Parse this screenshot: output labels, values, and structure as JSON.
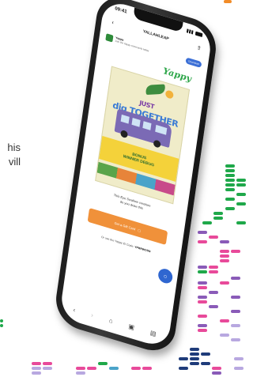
{
  "background_text": {
    "line1": "his",
    "line2": "vill"
  },
  "status_bar": {
    "time": "09:41"
  },
  "app_bar": {
    "title": "YALLAHLEAP",
    "back_icon": "back-arrow-icon",
    "share_icon": "share-icon"
  },
  "info_bar": {
    "name": "Yappy",
    "subtitle": "Join the Yappy community today",
    "button_label": "Download"
  },
  "brand": {
    "logo_text": "Yappy",
    "color": "#2ea64a"
  },
  "poster": {
    "headline_top": "JUST",
    "headline_main": "dig TOGETHER",
    "band_line1": "BONUS",
    "band_line2": "WINNER DEBUG"
  },
  "caption": {
    "line1": "This Eye Swallow creature",
    "line2": "do you draw this"
  },
  "cta": {
    "label": "Get a Gift Card",
    "color": "#f0913a"
  },
  "code_line": {
    "prefix": "Or use the Yappy ID Code:",
    "code": "YPBRWDSN"
  },
  "navbar": {
    "items": [
      "back-icon",
      "forward-icon",
      "home-icon",
      "tabs-icon",
      "bookmark-icon"
    ]
  },
  "decor_colors": {
    "pink": "#e84a9a",
    "green": "#1fa84a",
    "purple": "#8a5bb8",
    "orange": "#f28c28",
    "navy": "#1f3c7a",
    "lavender": "#b8a8e0"
  }
}
